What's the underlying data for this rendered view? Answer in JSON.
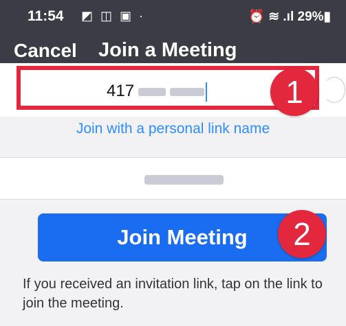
{
  "status_bar": {
    "time": "11:54",
    "left_icons": "◩ ◫ ▣ ·",
    "right_text": "⏰ ≋ .ıl 29%▮"
  },
  "nav": {
    "cancel_label": "Cancel",
    "title": "Join a Meeting"
  },
  "meeting_id_input": {
    "value_prefix": "417"
  },
  "badges": {
    "one": "1",
    "two": "2"
  },
  "personal_link_label": "Join with a personal link name",
  "join_button_label": "Join Meeting",
  "help_text": "If you received an invitation link, tap on the link to join the meeting."
}
